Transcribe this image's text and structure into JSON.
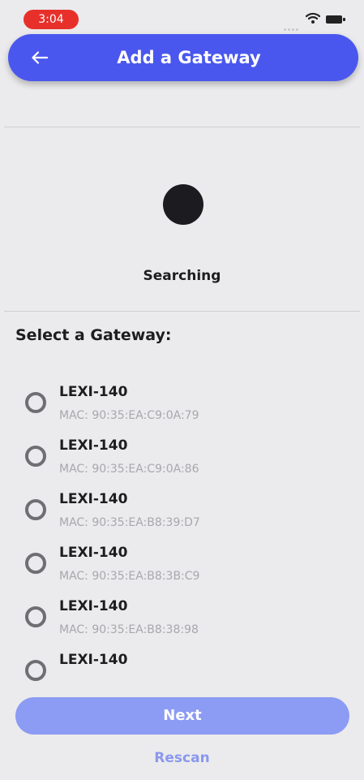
{
  "status_bar": {
    "time": "3:04",
    "time_pill_color": "#e8302b"
  },
  "app_bar": {
    "title": "Add a Gateway",
    "back_icon": "arrow-left-icon",
    "color": "#4a57ee"
  },
  "search": {
    "status_label": "Searching"
  },
  "gateway_section": {
    "title": "Select a Gateway:",
    "items": [
      {
        "name": "LEXI-140",
        "mac": "MAC: 90:35:EA:C9:0A:79"
      },
      {
        "name": "LEXI-140",
        "mac": "MAC: 90:35:EA:C9:0A:86"
      },
      {
        "name": "LEXI-140",
        "mac": "MAC: 90:35:EA:B8:39:D7"
      },
      {
        "name": "LEXI-140",
        "mac": "MAC: 90:35:EA:B8:3B:C9"
      },
      {
        "name": "LEXI-140",
        "mac": "MAC: 90:35:EA:B8:38:98"
      },
      {
        "name": "LEXI-140",
        "mac": ""
      }
    ]
  },
  "actions": {
    "next_label": "Next",
    "next_color": "#8c9bf3",
    "rescan_label": "Rescan"
  }
}
